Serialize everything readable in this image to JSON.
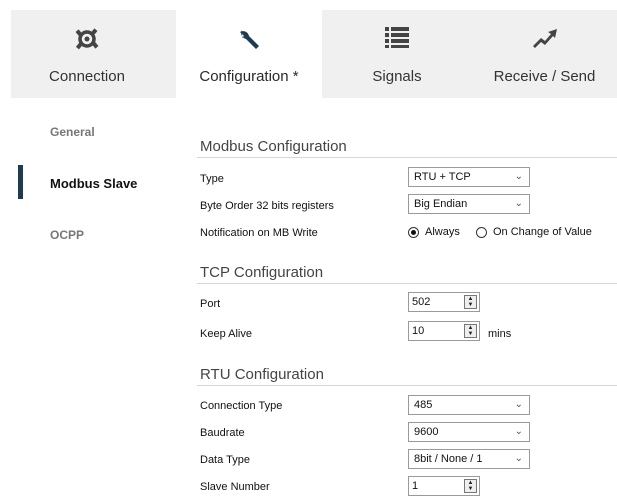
{
  "tabs": [
    {
      "label": "Connection",
      "icon": "plug-connection-icon"
    },
    {
      "label": "Configuration *",
      "icon": "wrench-icon"
    },
    {
      "label": "Signals",
      "icon": "list-icon"
    },
    {
      "label": "Receive / Send",
      "icon": "transfer-arrows-icon"
    }
  ],
  "sidebar": {
    "items": [
      {
        "label": "General"
      },
      {
        "label": "Modbus Slave"
      },
      {
        "label": "OCPP"
      }
    ]
  },
  "modbus": {
    "title": "Modbus Configuration",
    "type_label": "Type",
    "type_value": "RTU + TCP",
    "byte_order_label": "Byte Order 32 bits registers",
    "byte_order_value": "Big Endian",
    "notification_label": "Notification on MB Write",
    "notification_options": [
      "Always",
      "On Change of Value"
    ]
  },
  "tcp": {
    "title": "TCP Configuration",
    "port_label": "Port",
    "port_value": "502",
    "keepalive_label": "Keep Alive",
    "keepalive_value": "10",
    "keepalive_unit": "mins"
  },
  "rtu": {
    "title": "RTU Configuration",
    "conn_type_label": "Connection Type",
    "conn_type_value": "485",
    "baud_label": "Baudrate",
    "baud_value": "9600",
    "data_type_label": "Data Type",
    "data_type_value": "8bit / None / 1",
    "slave_label": "Slave Number",
    "slave_value": "1"
  },
  "colors": {
    "active_marker": "#1f3b4f",
    "tab_bg": "#f0f0f0"
  }
}
